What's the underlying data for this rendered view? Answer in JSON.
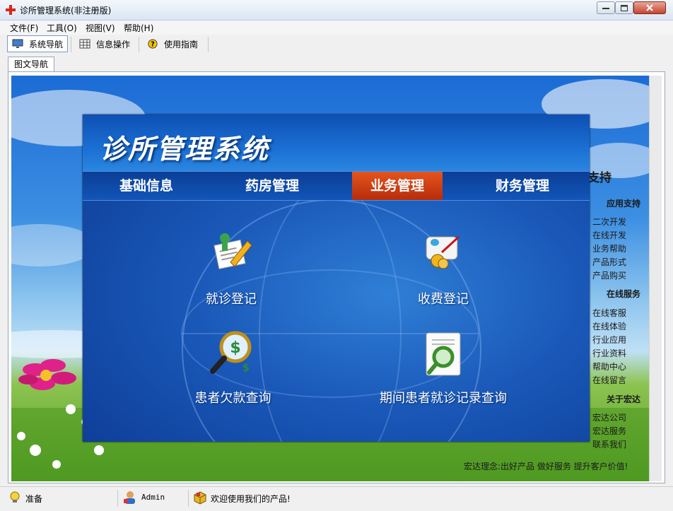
{
  "window": {
    "title": "诊所管理系统(非注册版)",
    "controls": {
      "minimize": "▭",
      "maximize": "□",
      "close": "✕"
    }
  },
  "menu": [
    "文件(F)",
    "工具(O)",
    "视图(V)",
    "帮助(H)"
  ],
  "toolbar": {
    "items": [
      {
        "label": "系统导航",
        "icon": "monitor-icon",
        "selected": true
      },
      {
        "label": "信息操作",
        "icon": "grid-icon",
        "selected": false
      },
      {
        "label": "使用指南",
        "icon": "help-icon",
        "selected": false
      }
    ]
  },
  "tabs": [
    {
      "label": "图文导航",
      "active": true
    }
  ],
  "right_column": {
    "heading_partial": "支持",
    "sections": [
      {
        "title": "应用支持",
        "items": [
          "二次开发",
          "在线开发",
          "业务帮助",
          "产品形式",
          "产品购买"
        ]
      },
      {
        "title": "在线服务",
        "items": [
          "在线客服",
          "在线体验",
          "行业应用",
          "行业资料",
          "帮助中心",
          "在线留言"
        ]
      },
      {
        "title": "关于宏达",
        "items": [
          "宏达公司",
          "宏达服务",
          "联系我们"
        ]
      }
    ],
    "slogan": "宏达理念:出好产品 做好服务 提升客户价值!"
  },
  "panel": {
    "title": "诊所管理系统",
    "nav": [
      {
        "label": "基础信息",
        "active": false
      },
      {
        "label": "药房管理",
        "active": false
      },
      {
        "label": "业务管理",
        "active": true
      },
      {
        "label": "财务管理",
        "active": false
      }
    ],
    "functions": [
      {
        "label": "就诊登记",
        "icon": "register-pencil-icon"
      },
      {
        "label": "收费登记",
        "icon": "fee-scroll-icon"
      },
      {
        "label": "患者欠款查询",
        "icon": "debt-magnifier-icon"
      },
      {
        "label": "期间患者就诊记录查询",
        "icon": "record-search-icon"
      }
    ],
    "colors": {
      "active_tab": "#d2401a",
      "panel_blue": "#1a58b8"
    }
  },
  "status_bar": {
    "status": "准备",
    "user": "Admin",
    "message": "欢迎使用我们的产品!"
  }
}
